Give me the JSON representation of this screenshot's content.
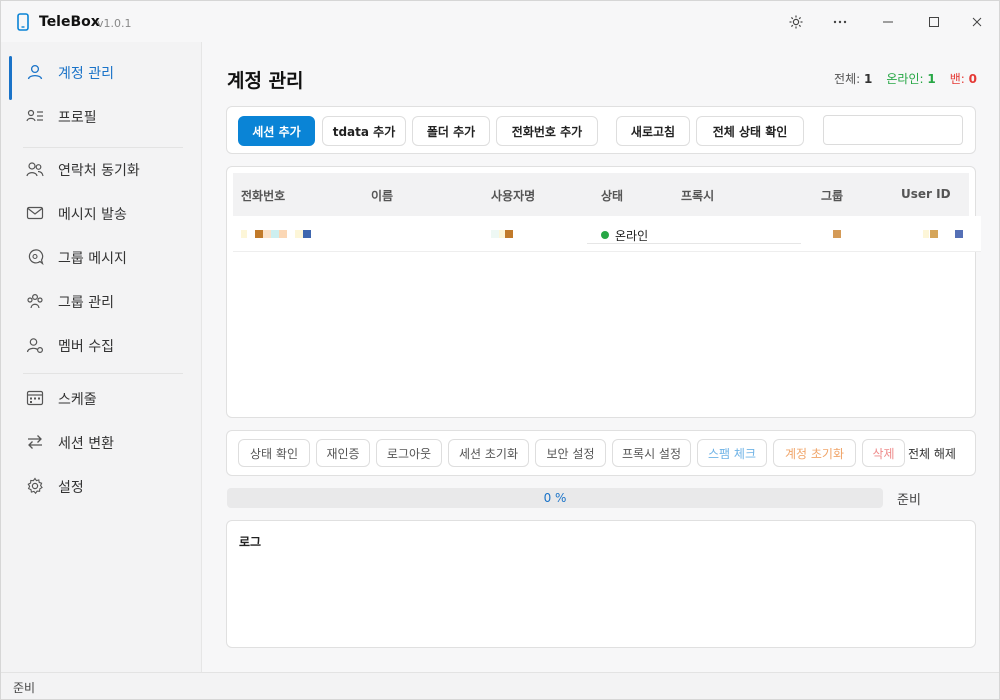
{
  "app": {
    "title": "TeleBox",
    "version": "v1.0.1"
  },
  "sidebar": {
    "items": [
      {
        "label": "계정 관리",
        "icon": "user-icon",
        "active": true
      },
      {
        "label": "프로필",
        "icon": "profile-list-icon"
      },
      {
        "label": "연락처 동기화",
        "icon": "contacts-sync-icon"
      },
      {
        "label": "메시지 발송",
        "icon": "mail-icon"
      },
      {
        "label": "그룹 메시지",
        "icon": "chat-icon"
      },
      {
        "label": "그룹 관리",
        "icon": "group-icon"
      },
      {
        "label": "멤버 수집",
        "icon": "member-collect-icon"
      },
      {
        "label": "스케줄",
        "icon": "calendar-icon"
      },
      {
        "label": "세션 변환",
        "icon": "swap-icon"
      },
      {
        "label": "설정",
        "icon": "gear-icon"
      }
    ]
  },
  "header": {
    "title": "계정 관리",
    "counts": {
      "total_label": "전체:",
      "total": "1",
      "online_label": "온라인:",
      "online": "1",
      "banned_label": "밴:",
      "banned": "0"
    }
  },
  "toolbar": {
    "add_session": "세션 추가",
    "add_tdata": "tdata 추가",
    "add_folder": "폴더 추가",
    "add_phone": "전화번호 추가",
    "refresh": "새로고침",
    "check_all": "전체 상태 확인",
    "search_placeholder": ""
  },
  "table": {
    "columns": [
      "전화번호",
      "이름",
      "사용자명",
      "상태",
      "프록시",
      "그룹",
      "User ID"
    ],
    "rows": [
      {
        "status": "온라인"
      }
    ]
  },
  "actions": {
    "check_status": "상태 확인",
    "reauth": "재인증",
    "logout": "로그아웃",
    "reset_session": "세션 초기화",
    "security": "보안 설정",
    "proxy": "프록시 설정",
    "spam_check": "스팸 체크",
    "reset_account": "계정 초기화",
    "delete": "삭제",
    "deselect_all": "전체 해제"
  },
  "progress": {
    "value": 0,
    "text": "0 %",
    "status": "준비"
  },
  "log": {
    "label": "로그"
  },
  "statusbar": {
    "text": "준비"
  },
  "colors": {
    "accent": "#0a84d6",
    "online": "#27a745",
    "banned": "#e53935",
    "spam": "#6fb3e6",
    "reset_account": "#f0a56a",
    "delete": "#ee8a8a"
  }
}
